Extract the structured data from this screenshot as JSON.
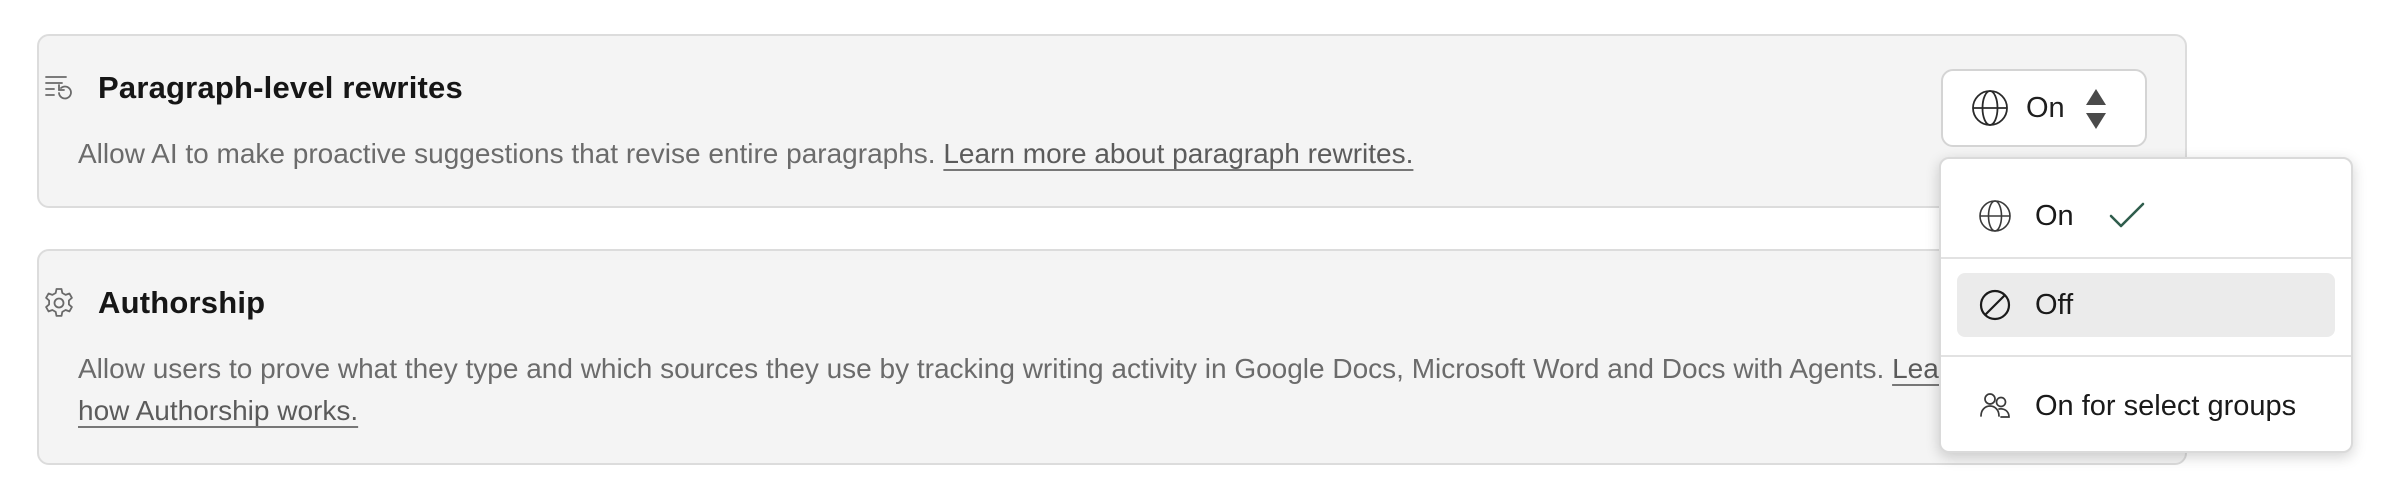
{
  "settings": {
    "paragraph": {
      "title": "Paragraph-level rewrites",
      "icon": "rewrite-icon",
      "description": "Allow AI to make proactive suggestions that revise entire paragraphs.",
      "link": "Learn more about paragraph rewrites.",
      "select": {
        "icon": "globe-icon",
        "value": "On"
      }
    },
    "authorship": {
      "title": "Authorship",
      "icon": "gear-icon",
      "description": "Allow users to prove what they type and which sources they use by tracking writing activity in Google Docs, Microsoft Word and Docs with Agents.",
      "link": "Learn how Authorship works."
    }
  },
  "dropdown": {
    "options": [
      {
        "label": "On",
        "icon": "globe-icon",
        "selected": true
      },
      {
        "label": "Off",
        "icon": "block-icon",
        "highlighted": true
      },
      {
        "label": "On for select groups",
        "icon": "users-icon"
      }
    ]
  },
  "colors": {
    "card_background": "#f4f4f4",
    "check_color": "#2f5d4c",
    "text_muted": "#6b6b6b"
  }
}
